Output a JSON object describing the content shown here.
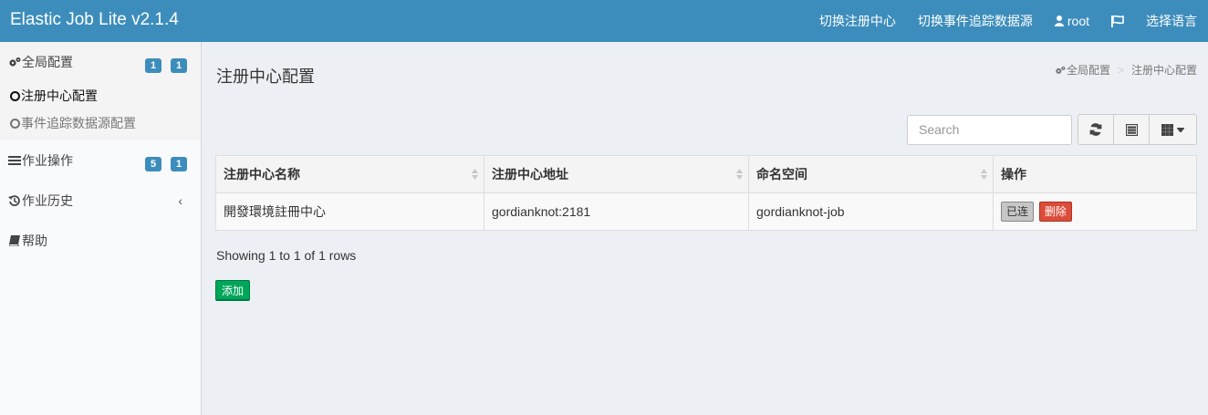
{
  "header": {
    "brand": "Elastic Job Lite v2.1.4",
    "nav": {
      "switch_registry": "切换注册中心",
      "switch_event_source": "切换事件追踪数据源",
      "user": "root",
      "language": "选择语言"
    }
  },
  "sidebar": {
    "global_config": {
      "label": "全局配置",
      "badges": [
        "1",
        "1"
      ]
    },
    "sub_items": [
      {
        "label": "注册中心配置"
      },
      {
        "label": "事件追踪数据源配置"
      }
    ],
    "job_ops": {
      "label": "作业操作",
      "badges": [
        "5",
        "1"
      ]
    },
    "job_history": {
      "label": "作业历史"
    },
    "help": {
      "label": "帮助"
    }
  },
  "content": {
    "title": "注册中心配置",
    "breadcrumb": {
      "root": "全局配置",
      "current": "注册中心配置"
    },
    "search_placeholder": "Search",
    "table": {
      "headers": [
        "注册中心名称",
        "注册中心地址",
        "命名空间",
        "操作"
      ],
      "rows": [
        {
          "name": "開發環境註冊中心",
          "address": "gordianknot:2181",
          "namespace": "gordianknot-job",
          "connected_label": "已连",
          "delete_label": "删除"
        }
      ]
    },
    "pagination_info": "Showing 1 to 1 of 1 rows",
    "add_label": "添加"
  }
}
